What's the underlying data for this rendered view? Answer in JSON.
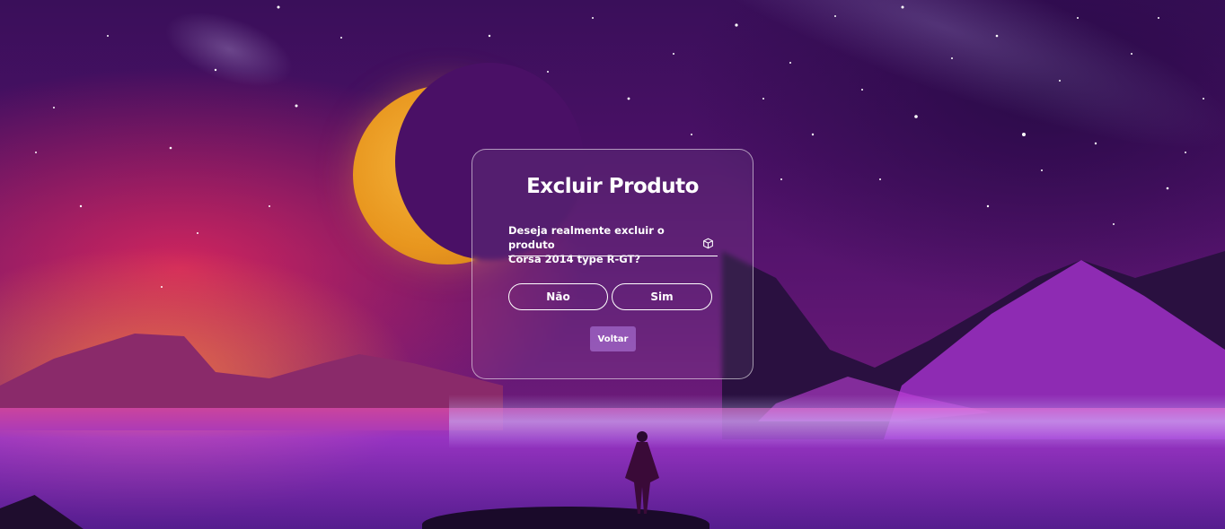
{
  "dialog": {
    "title": "Excluir Produto",
    "message_line1": "Deseja realmente excluir o produto",
    "message_line2": "Corsa 2014 type R-GT?",
    "no_label": "Não",
    "yes_label": "Sim",
    "back_label": "Voltar"
  },
  "icons": {
    "field_icon": "cube-icon"
  },
  "colors": {
    "text": "#ffffff",
    "border": "#ffffff",
    "back_button_bg": "#b07adf"
  }
}
